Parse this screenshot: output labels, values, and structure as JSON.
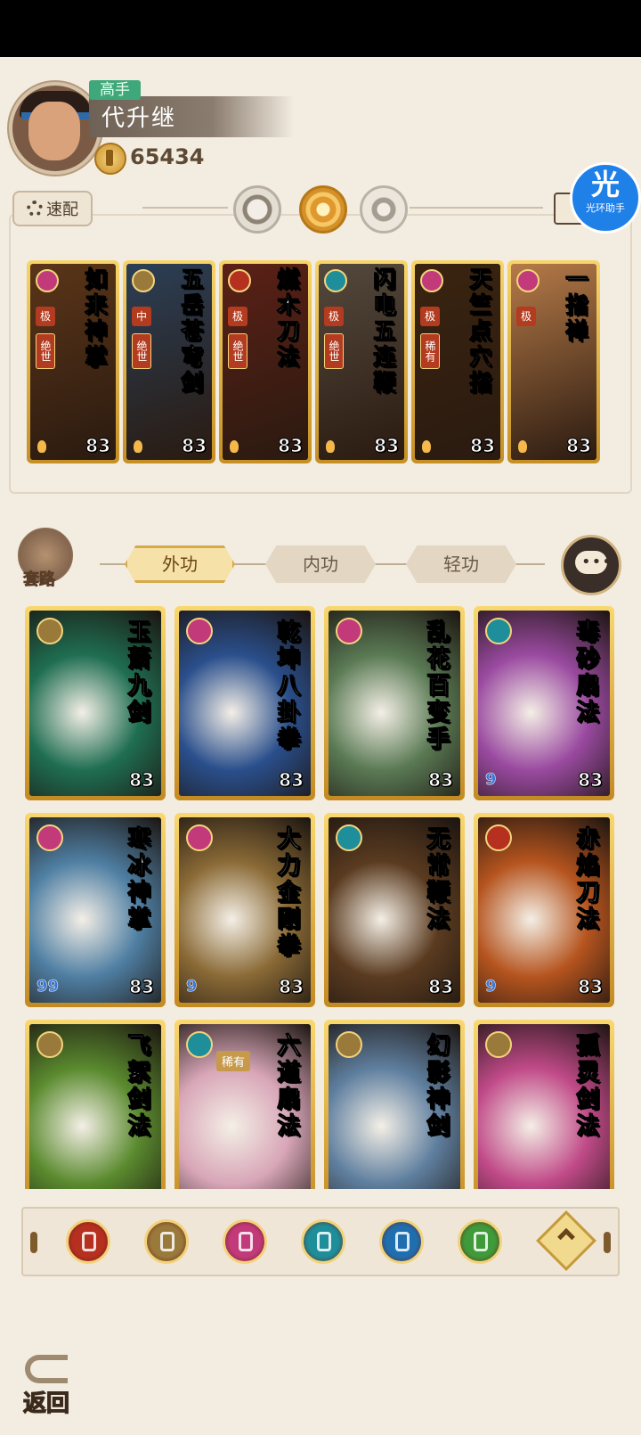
{
  "player": {
    "rank": "高手",
    "name": "代升继",
    "coins": "65434"
  },
  "toolbar": {
    "quick_label": "速配"
  },
  "helper": {
    "icon_text": "光",
    "label": "光环助手"
  },
  "equipped": [
    {
      "title": "如来神掌",
      "ranks": [
        "极",
        "绝世"
      ],
      "level": "83",
      "color": "#5a3518",
      "type_color": "#c23a7a"
    },
    {
      "title": "五岳苍穹剑",
      "ranks": [
        "中",
        "绝世"
      ],
      "level": "83",
      "color": "#2b3f56",
      "type_color": "#9a7a3a"
    },
    {
      "title": "燃木刀法",
      "ranks": [
        "极",
        "绝世"
      ],
      "level": "83",
      "color": "#5b2016",
      "type_color": "#b63020"
    },
    {
      "title": "闪电五连鞭",
      "ranks": [
        "极",
        "绝世"
      ],
      "level": "83",
      "color": "#54493d",
      "type_color": "#1e8e9a"
    },
    {
      "title": "天竺点穴指",
      "ranks": [
        "极",
        "稀有"
      ],
      "level": "83",
      "color": "#3a2410",
      "type_color": "#c23a7a"
    },
    {
      "title": "一指禅",
      "ranks": [
        "极"
      ],
      "level": "83",
      "color": "#b57a48",
      "type_color": "#c23a7a"
    }
  ],
  "tabs": {
    "set_label": "套路",
    "items": [
      "外功",
      "内功",
      "轻功"
    ]
  },
  "skills": [
    {
      "title": "玉萧九剑",
      "level": "83",
      "bg": "#1f6e52",
      "type_color": "#9a7a3a",
      "water": ""
    },
    {
      "title": "乾坤八卦拳",
      "level": "83",
      "bg": "#2a4f8c",
      "type_color": "#c23a7a",
      "water": ""
    },
    {
      "title": "乱花百变手",
      "level": "83",
      "bg": "#5a7a54",
      "type_color": "#c23a7a",
      "water": ""
    },
    {
      "title": "毒砂扇法",
      "level": "83",
      "bg": "#9a4aa0",
      "type_color": "#1e8e9a",
      "water": "9"
    },
    {
      "title": "寒冰神掌",
      "level": "83",
      "bg": "#4f7fa3",
      "type_color": "#c23a7a",
      "water": "99"
    },
    {
      "title": "大力金刚拳",
      "level": "83",
      "bg": "#8a6a36",
      "type_color": "#c23a7a",
      "water": "9"
    },
    {
      "title": "无常鞭法",
      "level": "83",
      "bg": "#5a3b20",
      "type_color": "#1e8e9a",
      "water": ""
    },
    {
      "title": "赤焰刀法",
      "level": "83",
      "bg": "#b5541e",
      "type_color": "#b63020",
      "water": "9"
    },
    {
      "title": "飞絮剑法",
      "level": "",
      "bg": "#5a8a2e",
      "type_color": "#9a7a3a",
      "water": "",
      "rare": ""
    },
    {
      "title": "六道扇法",
      "level": "",
      "bg": "#d8a6b8",
      "type_color": "#1e8e9a",
      "water": "",
      "rare": "稀有"
    },
    {
      "title": "幻影神剑",
      "level": "",
      "bg": "#5f7f9f",
      "type_color": "#9a7a3a",
      "water": "",
      "rare": ""
    },
    {
      "title": "孤灵剑法",
      "level": "",
      "bg": "#c04a88",
      "type_color": "#9a7a3a",
      "water": "",
      "rare": ""
    }
  ],
  "filters": [
    {
      "name": "blade-filter-icon",
      "color": "#b63020"
    },
    {
      "name": "sword-filter-icon",
      "color": "#9a7a3a"
    },
    {
      "name": "fist-filter-icon",
      "color": "#c23a7a"
    },
    {
      "name": "fan-filter-icon",
      "color": "#1e8e9a"
    },
    {
      "name": "taiji-filter-icon",
      "color": "#1f6fb0"
    },
    {
      "name": "whip-filter-icon",
      "color": "#3f9a3a"
    }
  ],
  "footer": {
    "back_label": "返回"
  }
}
